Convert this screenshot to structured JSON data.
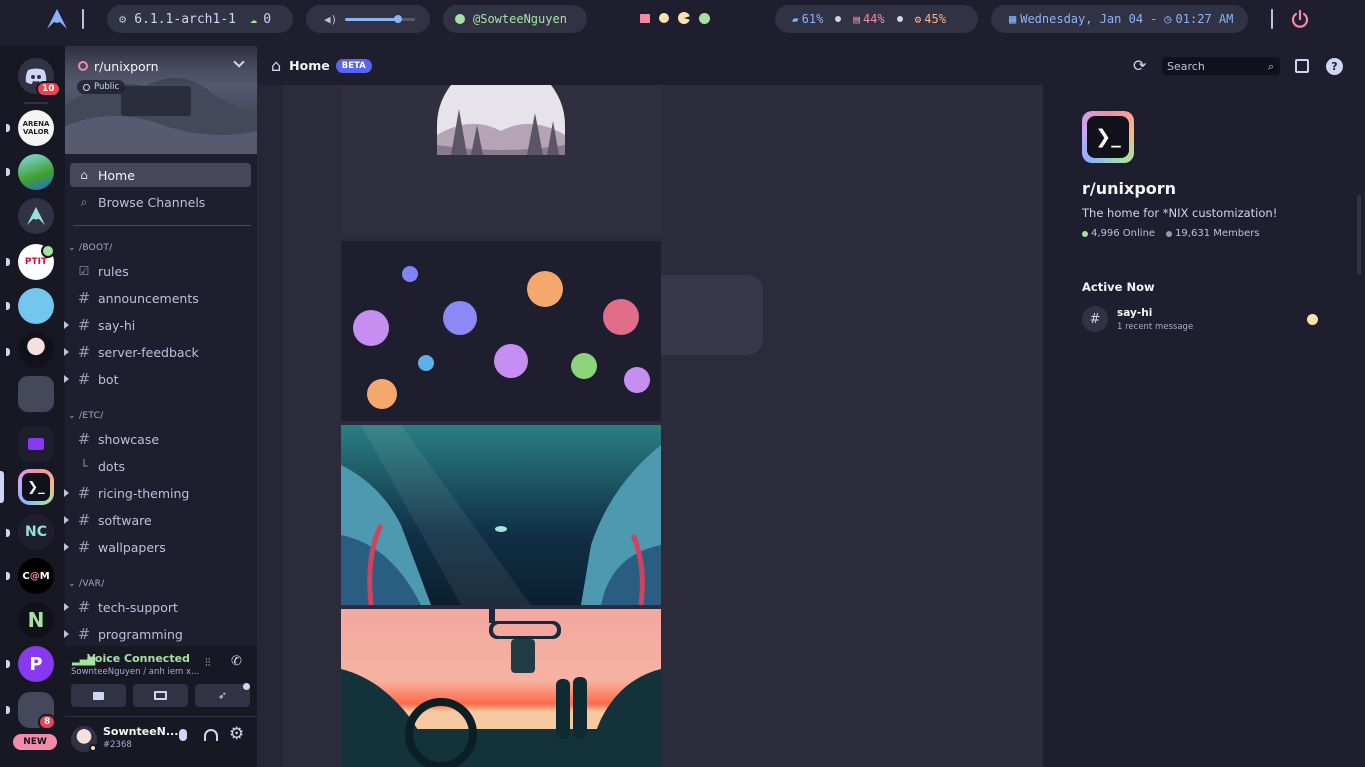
{
  "topbar": {
    "kernel": "6.1.1-arch1-1",
    "updates": "0",
    "github_user": "@SowteeNguyen",
    "stats": {
      "disk": "61%",
      "memory": "44%",
      "cpu": "45%"
    },
    "datetime": {
      "date": "Wednesday, Jan 04",
      "dash": "-",
      "time": "01:27 AM"
    },
    "volume_level": 0.75
  },
  "servers": {
    "home_badge": "10",
    "last_badge": "8",
    "new_label": "NEW"
  },
  "sidebar": {
    "server_name": "r/unixporn",
    "visibility": "Public",
    "nav": [
      {
        "label": "Home",
        "icon": "home-icon"
      },
      {
        "label": "Browse Channels",
        "icon": "browse-icon"
      }
    ],
    "categories": [
      {
        "name": "/BOOT/",
        "channels": [
          "rules",
          "announcements",
          "say-hi",
          "server-feedback",
          "bot"
        ]
      },
      {
        "name": "/ETC/",
        "channels": [
          "showcase",
          "dots",
          "ricing-theming",
          "software",
          "wallpapers"
        ]
      },
      {
        "name": "/VAR/",
        "channels": [
          "tech-support",
          "programming"
        ]
      }
    ],
    "voice": {
      "status": "Voice Connected",
      "detail": "SownteeNguyen / anh iem x..."
    },
    "user": {
      "name": "SownteeN...",
      "tag": "#2368"
    }
  },
  "header": {
    "title": "Home",
    "beta": "BETA",
    "search_placeholder": "Search"
  },
  "right_panel": {
    "community_name": "r/unixporn",
    "description": "The home for *NIX customization!",
    "online": "4,996 Online",
    "members": "19,631 Members",
    "active_heading": "Active Now",
    "active_channel": "say-hi",
    "active_detail": "1 recent message"
  },
  "colors": {
    "bg": "#1e1e2e",
    "accent": "#89b4fa",
    "green": "#a6e3a1",
    "red": "#f38ba8",
    "peach": "#fab387",
    "beta": "#5865f2"
  }
}
